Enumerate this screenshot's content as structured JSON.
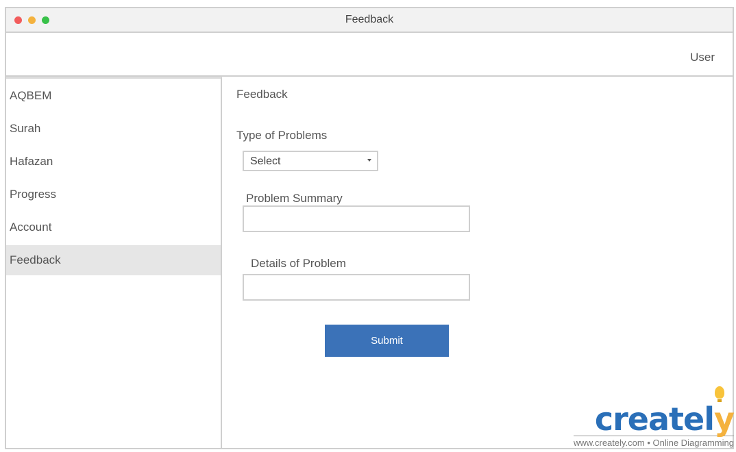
{
  "window": {
    "title": "Feedback"
  },
  "header": {
    "user_label": "User"
  },
  "sidebar": {
    "items": [
      {
        "label": "AQBEM"
      },
      {
        "label": "Surah"
      },
      {
        "label": "Hafazan"
      },
      {
        "label": "Progress"
      },
      {
        "label": "Account"
      },
      {
        "label": "Feedback"
      }
    ]
  },
  "main": {
    "title": "Feedback",
    "type_label": "Type of Problems",
    "type_select_value": "Select",
    "summary_label": "Problem Summary",
    "details_label": "Details of Problem",
    "submit_label": "Submit"
  },
  "watermark": {
    "brand_main": "creatl",
    "brand_accent": "y",
    "brand_prefix": "crea",
    "brand_t": "te",
    "text": "www.creately.com • Online Diagramming"
  }
}
